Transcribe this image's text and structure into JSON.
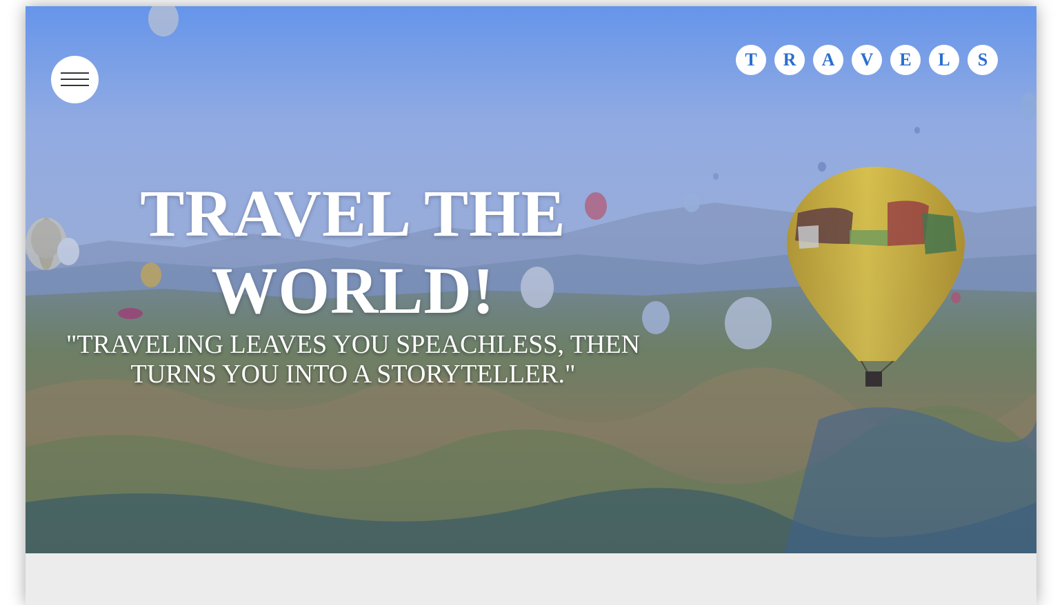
{
  "nav": {
    "menu_icon": "hamburger-menu-icon",
    "brand_letters": [
      "T",
      "R",
      "A",
      "V",
      "E",
      "L",
      "S"
    ],
    "accent_color": "#2a6fd0"
  },
  "hero": {
    "headline_line1": "TRAVEL THE",
    "headline_line2": "WORLD!",
    "quote": "\"TRAVELING LEAVES YOU SPEACHLESS, THEN TURNS YOU INTO A STORYTELLER.\"",
    "background_image": "hot-air-balloons-over-valley"
  }
}
